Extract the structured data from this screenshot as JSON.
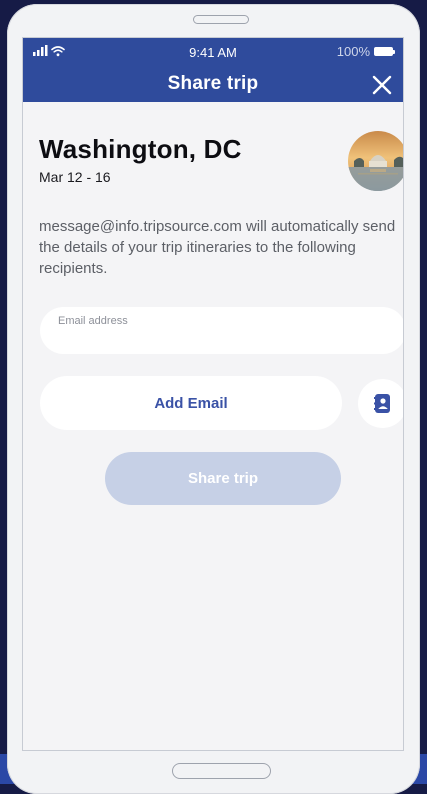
{
  "status_bar": {
    "time": "9:41 AM",
    "battery": "100%"
  },
  "header": {
    "title": "Share trip"
  },
  "trip": {
    "title": "Washington, DC",
    "dates": "Mar 12 - 16"
  },
  "description": "message@info.tripsource.com will automatically send the details of your trip itineraries to the following recipients.",
  "email_field": {
    "label": "Email address",
    "value": ""
  },
  "buttons": {
    "add_email": "Add Email",
    "share_trip": "Share trip"
  },
  "icons": {
    "signal": "signal-icon",
    "wifi": "wifi-icon",
    "battery": "battery-icon",
    "close": "close-icon",
    "contacts": "contact-book-icon"
  },
  "colors": {
    "header": "#2f4b9c",
    "accent": "#3a52a6",
    "disabled_button": "#c6d0e6",
    "page_background": "#161b46"
  }
}
